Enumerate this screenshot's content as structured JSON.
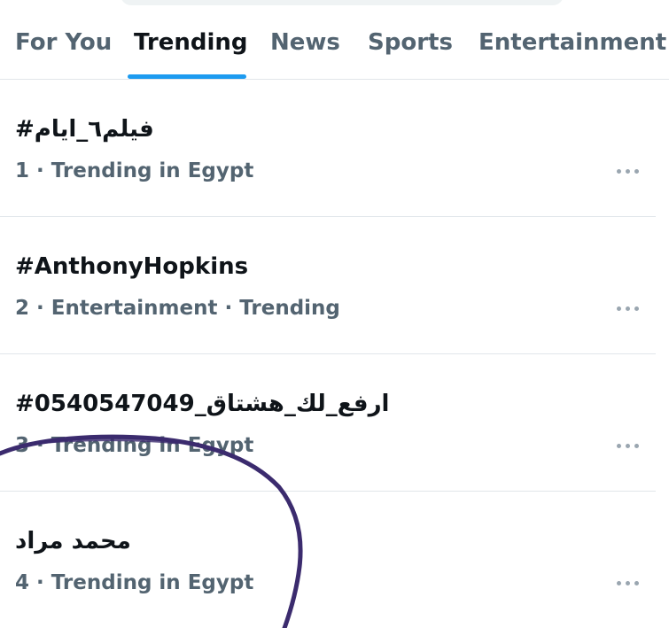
{
  "tabs": [
    {
      "label": "For You"
    },
    {
      "label": "Trending"
    },
    {
      "label": "News"
    },
    {
      "label": "Sports"
    },
    {
      "label": "Entertainment"
    }
  ],
  "active_tab": "Trending",
  "accent_color": "#1d9bf0",
  "trends": [
    {
      "title": "#فيلم٦_ايام",
      "meta": "1 · Trending in Egypt"
    },
    {
      "title": "#AnthonyHopkins",
      "meta": "2 · Entertainment · Trending"
    },
    {
      "title": "#ارفع_لك_هشتاق_0540547049",
      "meta": "3 · Trending in Egypt"
    },
    {
      "title": "محمد مراد",
      "meta": "4 · Trending in Egypt"
    }
  ],
  "icons": {
    "more": "more-horizontal-icon"
  }
}
